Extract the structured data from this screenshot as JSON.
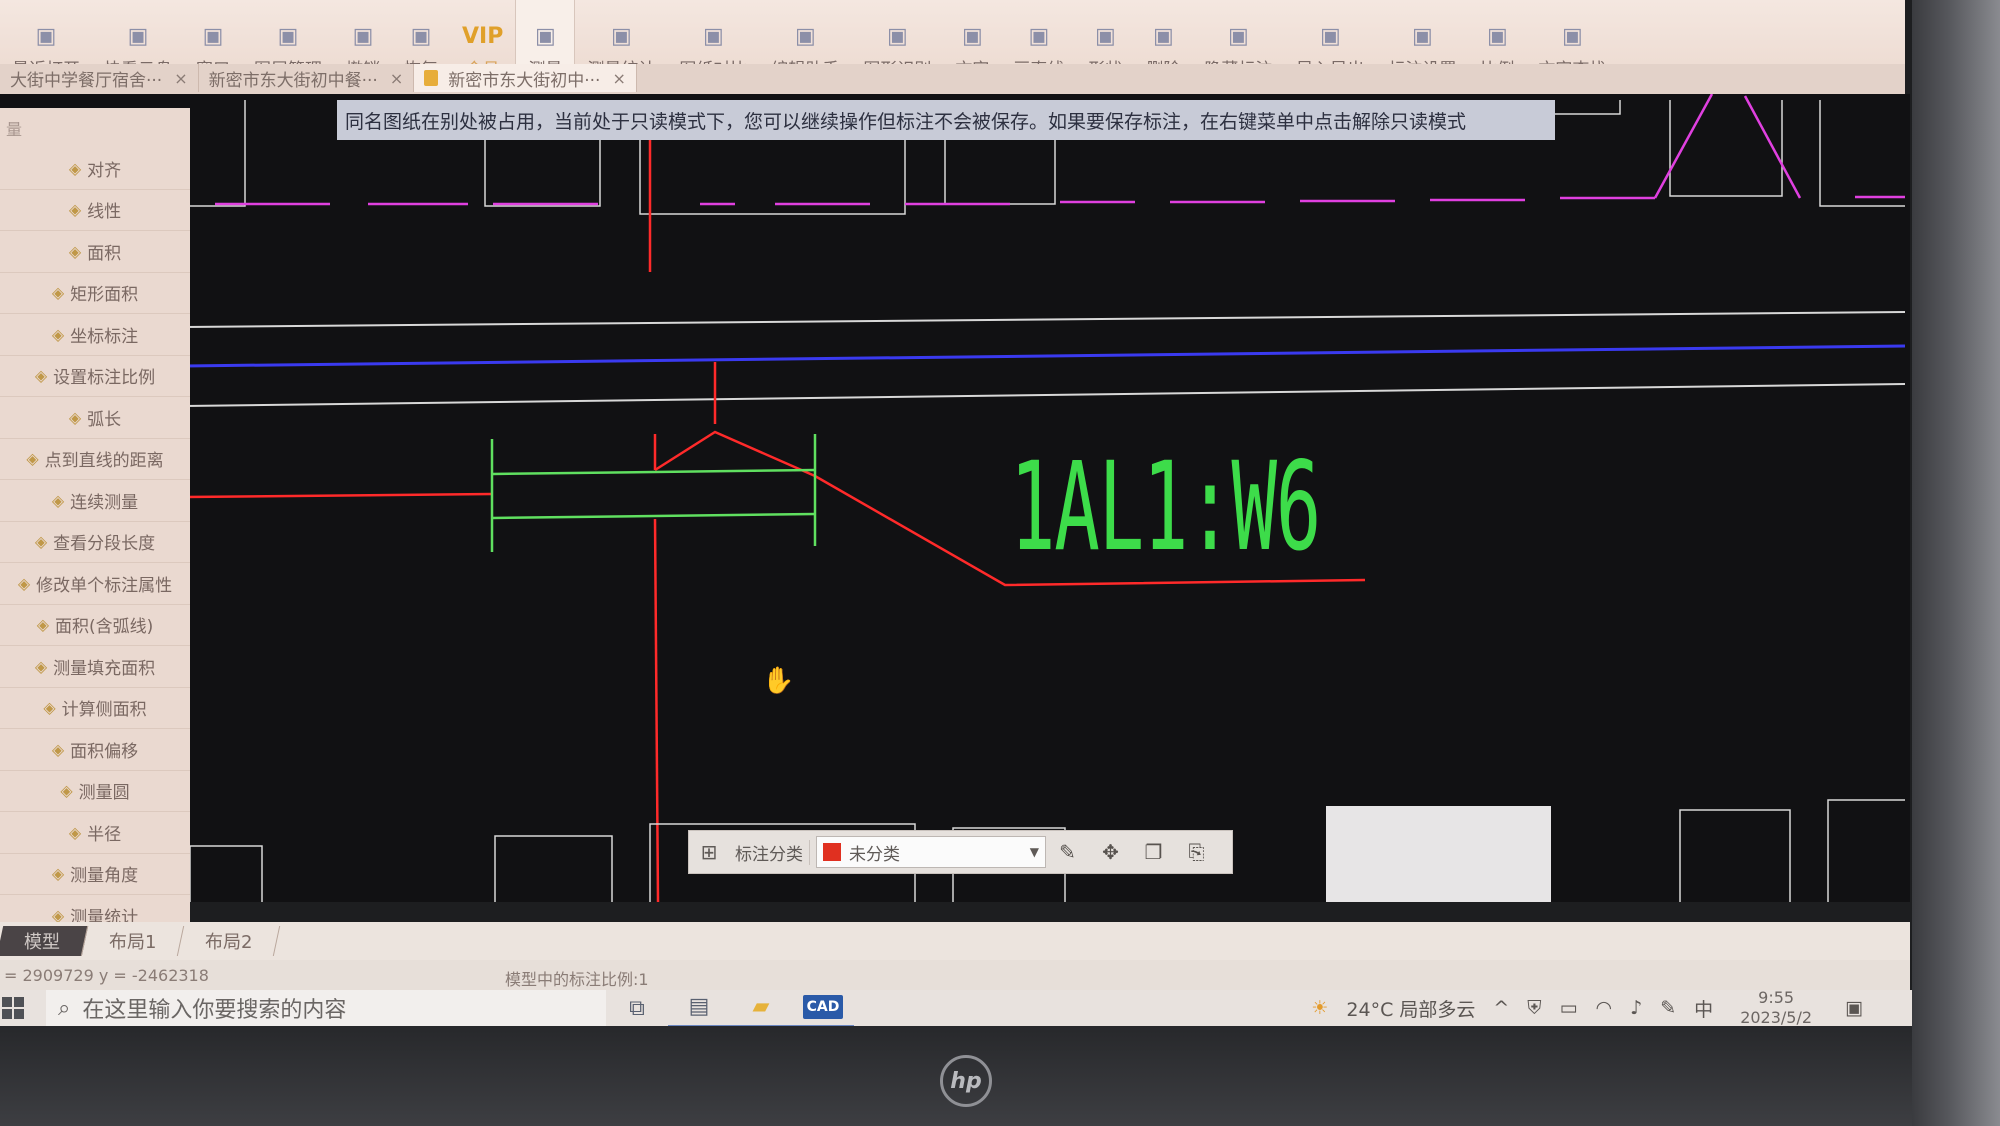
{
  "toolbar": {
    "items": [
      {
        "label": "最近打开",
        "icon": "clock-icon"
      },
      {
        "label": "快看云盘",
        "icon": "cloud-icon"
      },
      {
        "label": "窗口",
        "icon": "window-icon"
      },
      {
        "label": "图层管理",
        "icon": "layers-icon"
      },
      {
        "label": "撤销",
        "icon": "undo-icon"
      },
      {
        "label": "恢复",
        "icon": "redo-icon"
      },
      {
        "label": "会员",
        "icon": "vip-icon",
        "glyph": "VIP"
      },
      {
        "label": "测量",
        "icon": "ruler-icon",
        "active": true
      },
      {
        "label": "测量统计",
        "icon": "stats-icon"
      },
      {
        "label": "图纸对比",
        "icon": "compare-icon"
      },
      {
        "label": "编辑助手",
        "icon": "edit-assist-icon"
      },
      {
        "label": "图形识别",
        "icon": "shape-recognition-icon"
      },
      {
        "label": "文字",
        "icon": "text-icon"
      },
      {
        "label": "画直线",
        "icon": "line-icon"
      },
      {
        "label": "形状",
        "icon": "shape-icon"
      },
      {
        "label": "删除",
        "icon": "eraser-icon"
      },
      {
        "label": "隐藏标注",
        "icon": "hide-annotation-icon"
      },
      {
        "label": "导入导出",
        "icon": "import-export-icon"
      },
      {
        "label": "标注设置",
        "icon": "annotation-settings-icon"
      },
      {
        "label": "比例",
        "icon": "scale-icon"
      },
      {
        "label": "文字查找",
        "icon": "find-text-icon"
      }
    ]
  },
  "tabs": [
    {
      "label": "大街中学餐厅宿舍···"
    },
    {
      "label": "新密市东大街初中餐···"
    },
    {
      "label": "新密市东大街初中···",
      "active": true,
      "locked": true
    }
  ],
  "warning": "同名图纸在别处被占用，当前处于只读模式下，您可以继续操作但标注不会被保存。如果要保存标注，在右键菜单中点击解除只读模式",
  "panel": {
    "header": "量",
    "items": [
      "对齐",
      "线性",
      "面积",
      "矩形面积",
      "坐标标注",
      "设置标注比例",
      "弧长",
      "点到直线的距离",
      "连续测量",
      "查看分段长度",
      "修改单个标注属性",
      "面积(含弧线)",
      "测量填充面积",
      "计算侧面积",
      "面积偏移",
      "测量圆",
      "半径",
      "测量角度",
      "测量统计"
    ]
  },
  "drawing": {
    "label": "1AL1:W6",
    "colors": {
      "label": "#3ddc4a",
      "red": "#ff2a2a",
      "magenta": "#e040e0",
      "blue": "#3a3af0",
      "green": "#60e060",
      "white": "#d8d8d8"
    }
  },
  "annotation_bar": {
    "label": "标注分类",
    "category": "未分类",
    "swatch_color": "#e03020"
  },
  "layout_tabs": [
    "模型",
    "布局1",
    "布局2"
  ],
  "status": {
    "coord": "= 2909729  y = -2462318",
    "scale": "模型中的标注比例:1"
  },
  "taskbar": {
    "search_placeholder": "在这里输入你要搜索的内容",
    "weather": "24°C  局部多云",
    "ime": "中",
    "time": "9:55",
    "date": "2023/5/2",
    "cad_label": "CAD"
  }
}
